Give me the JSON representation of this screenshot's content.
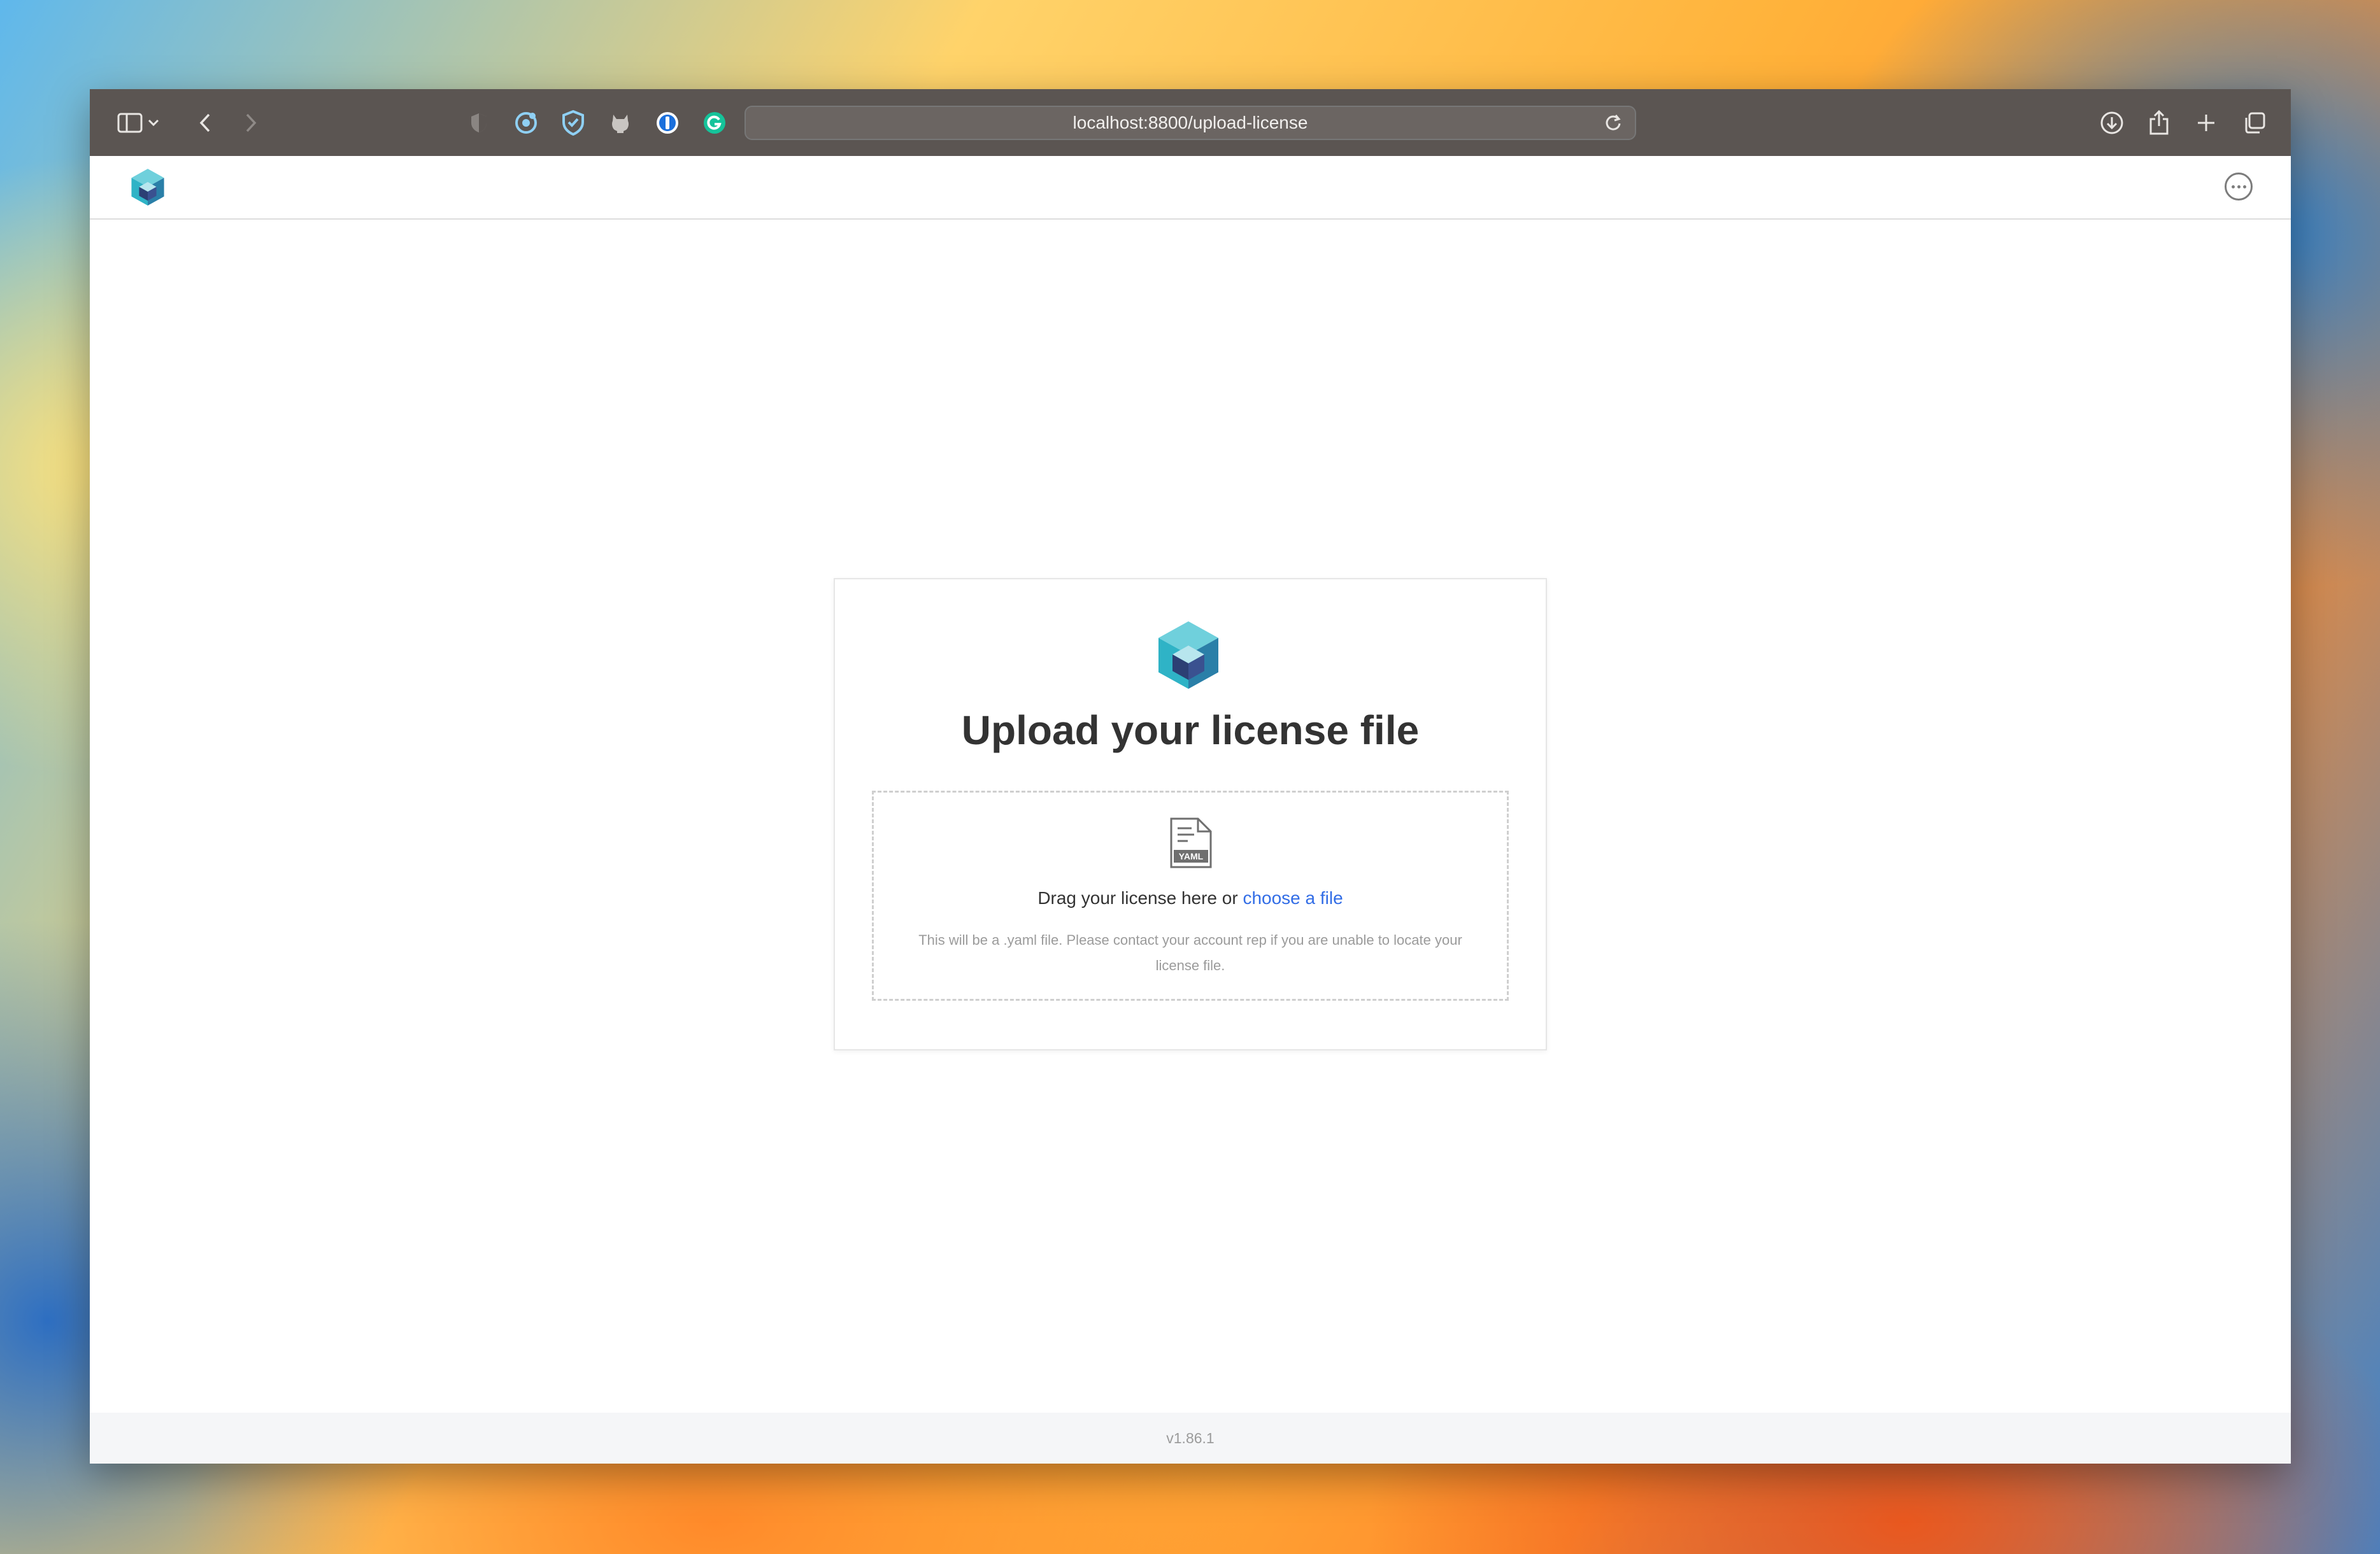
{
  "browser": {
    "url": "localhost:8800/upload-license",
    "icons": [
      "sidebar-icon",
      "chevron-down-icon",
      "back-icon",
      "forward-icon",
      "privacy-shield-icon",
      "extension-icon",
      "shield-check-icon",
      "github-icon",
      "password-manager-icon",
      "grammar-icon",
      "reload-icon",
      "download-icon",
      "share-icon",
      "new-tab-icon",
      "tabs-overview-icon"
    ]
  },
  "header": {
    "logo": "cube-logo-icon",
    "more": "more-icon"
  },
  "card": {
    "title": "Upload your license file",
    "drop_prompt": "Drag your license here or ",
    "choose_link": "choose a file",
    "help": "This will be a .yaml file. Please contact your account rep if you are unable to locate your license file.",
    "file_icon_label": "YAML"
  },
  "footer": {
    "version": "v1.86.1"
  },
  "colors": {
    "toolbar": "#5b5552",
    "link": "#326de6",
    "title": "#333333",
    "cube_teal": "#2fb3c6",
    "cube_dark": "#2c3f74"
  }
}
